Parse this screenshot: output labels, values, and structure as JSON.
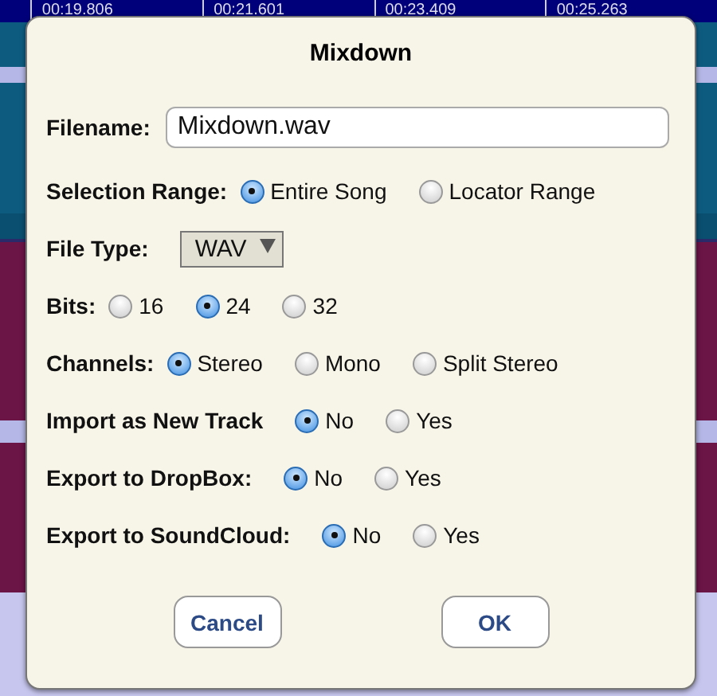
{
  "timeline": {
    "ticks": [
      "00:19.806",
      "00:21.601",
      "00:23.409",
      "00:25.263"
    ]
  },
  "dialog": {
    "title": "Mixdown",
    "filename": {
      "label": "Filename:",
      "value": "Mixdown.wav"
    },
    "fields": [
      {
        "kind": "radio",
        "label": "Selection Range:",
        "options": [
          {
            "label": "Entire Song",
            "selected": true
          },
          {
            "label": "Locator Range",
            "selected": false
          }
        ]
      },
      {
        "kind": "select",
        "label": "File Type:",
        "value": "WAV"
      },
      {
        "kind": "radio",
        "label": "Bits:",
        "options": [
          {
            "label": "16",
            "selected": false
          },
          {
            "label": "24",
            "selected": true
          },
          {
            "label": "32",
            "selected": false
          }
        ]
      },
      {
        "kind": "radio",
        "label": "Channels:",
        "options": [
          {
            "label": "Stereo",
            "selected": true
          },
          {
            "label": "Mono",
            "selected": false
          },
          {
            "label": "Split Stereo",
            "selected": false
          }
        ]
      },
      {
        "kind": "radio",
        "label": "Import as New Track",
        "options": [
          {
            "label": "No",
            "selected": true
          },
          {
            "label": "Yes",
            "selected": false
          }
        ]
      },
      {
        "kind": "radio",
        "label": "Export to DropBox:",
        "options": [
          {
            "label": "No",
            "selected": true
          },
          {
            "label": "Yes",
            "selected": false
          }
        ]
      },
      {
        "kind": "radio",
        "label": "Export to SoundCloud:",
        "options": [
          {
            "label": "No",
            "selected": true
          },
          {
            "label": "Yes",
            "selected": false
          }
        ]
      }
    ],
    "buttons": [
      "Cancel",
      "OK"
    ]
  }
}
